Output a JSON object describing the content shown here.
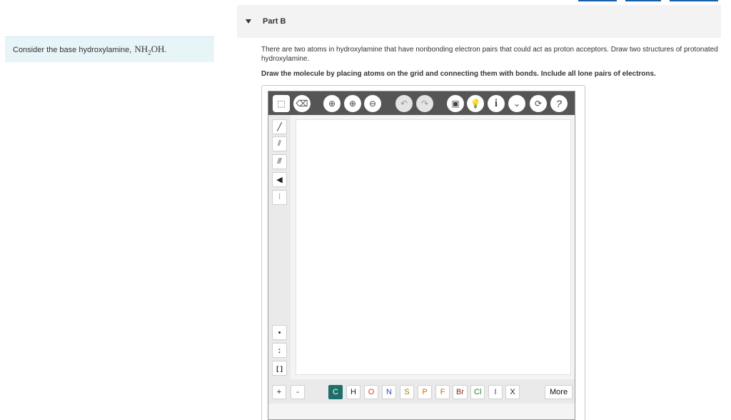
{
  "header": {
    "part_label": "Part B"
  },
  "context": {
    "text": "Consider the base hydroxylamine, ",
    "formula_a": "NH",
    "formula_sub": "2",
    "formula_b": "OH",
    "formula_end": "."
  },
  "question": {
    "text": "There are two atoms in hydroxylamine that have nonbonding electron pairs that could act as proton acceptors. Draw two structures of protonated hydroxylamine.",
    "instruction": "Draw the molecule by placing atoms on the grid and connecting them with bonds. Include all lone pairs of electrons."
  },
  "editor": {
    "top_tools": [
      {
        "name": "select-icon",
        "glyph": "⬚"
      },
      {
        "name": "eraser-icon",
        "glyph": "⌫"
      },
      {
        "name": "zoom-fit-icon",
        "glyph": "⊕"
      },
      {
        "name": "zoom-in-icon",
        "glyph": "⊕"
      },
      {
        "name": "zoom-out-icon",
        "glyph": "⊖"
      },
      {
        "name": "undo-icon",
        "glyph": "↶"
      },
      {
        "name": "redo-icon",
        "glyph": "↷"
      },
      {
        "name": "template-icon",
        "glyph": "▣"
      },
      {
        "name": "hint-icon",
        "glyph": "💡"
      },
      {
        "name": "info-icon",
        "glyph": "i"
      },
      {
        "name": "chevron-down-icon",
        "glyph": "⌄"
      },
      {
        "name": "reset-icon",
        "glyph": "⟳"
      },
      {
        "name": "help-icon",
        "glyph": "?"
      }
    ],
    "left_tools": [
      {
        "name": "single-bond-icon",
        "glyph": "╱"
      },
      {
        "name": "double-bond-icon",
        "glyph": "⫽"
      },
      {
        "name": "triple-bond-icon",
        "glyph": "⫻"
      },
      {
        "name": "wedge-bond-icon",
        "glyph": "◀"
      },
      {
        "name": "hash-bond-icon",
        "glyph": "⫶"
      },
      {
        "name": "radical-icon",
        "glyph": "•"
      },
      {
        "name": "lone-pair-icon",
        "glyph": ":"
      },
      {
        "name": "bracket-icon",
        "glyph": "[ ]"
      }
    ],
    "charges": [
      "+",
      "-"
    ],
    "atoms": [
      "C",
      "H",
      "O",
      "N",
      "S",
      "P",
      "F",
      "Br",
      "Cl",
      "I",
      "X"
    ],
    "more_label": "More",
    "colors": {
      "toolbar": "#555555",
      "carbon": "#1f6e6a",
      "link": "#1a5fa8"
    }
  }
}
